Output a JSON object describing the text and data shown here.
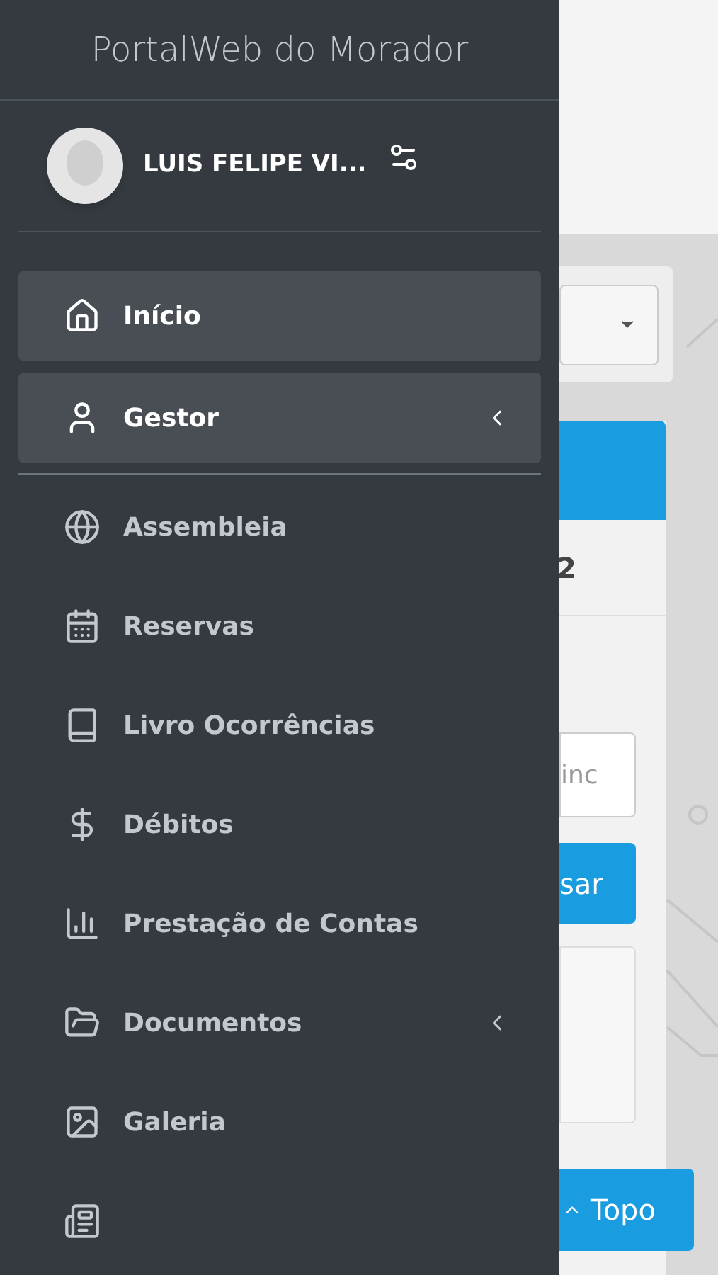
{
  "sidebar": {
    "title": "PortalWeb do Morador",
    "user": {
      "name": "LUIS FELIPE VI..."
    },
    "items": [
      {
        "label": "Início",
        "kind": "link",
        "selected": true
      },
      {
        "label": "Gestor",
        "kind": "submenu",
        "selected": true
      },
      {
        "label": "Assembleia",
        "kind": "link",
        "selected": false
      },
      {
        "label": "Reservas",
        "kind": "link",
        "selected": false
      },
      {
        "label": "Livro Ocorrências",
        "kind": "link",
        "selected": false
      },
      {
        "label": "Débitos",
        "kind": "link",
        "selected": false
      },
      {
        "label": "Prestação de Contas",
        "kind": "link",
        "selected": false
      },
      {
        "label": "Documentos",
        "kind": "submenu",
        "selected": false
      },
      {
        "label": "Galeria",
        "kind": "link",
        "selected": false
      },
      {
        "kind": "link",
        "selected": false
      }
    ]
  },
  "content": {
    "card_text": "2",
    "field_placeholder": "inc",
    "search_button": "sar",
    "top_button": "Topo"
  }
}
